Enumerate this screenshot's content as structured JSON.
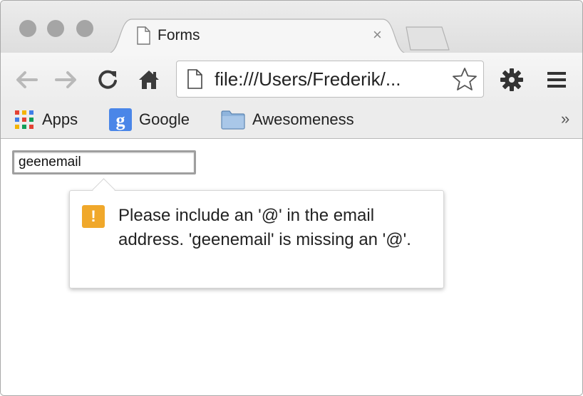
{
  "window": {
    "colors": {
      "chrome_bg": "#ececec",
      "warning": "#f0a82b"
    }
  },
  "tab": {
    "title": "Forms",
    "close_glyph": "×",
    "icon": "page-icon"
  },
  "toolbar": {
    "back_icon": "back-arrow-icon",
    "forward_icon": "forward-arrow-icon",
    "reload_icon": "reload-icon",
    "home_icon": "home-icon",
    "url": "file:///Users/Frederik/...",
    "star_icon": "star-icon",
    "settings_icon": "gear-icon",
    "menu_icon": "hamburger-menu-icon"
  },
  "bookmarks": {
    "items": [
      {
        "label": "Apps",
        "icon": "apps-grid-icon"
      },
      {
        "label": "Google",
        "icon": "google-icon"
      },
      {
        "label": "Awesomeness",
        "icon": "folder-icon"
      }
    ],
    "overflow": "»"
  },
  "form": {
    "email_value": "geenemail"
  },
  "validation": {
    "icon_glyph": "!",
    "message": "Please include an '@' in the email address. 'geenemail' is missing an '@'."
  }
}
